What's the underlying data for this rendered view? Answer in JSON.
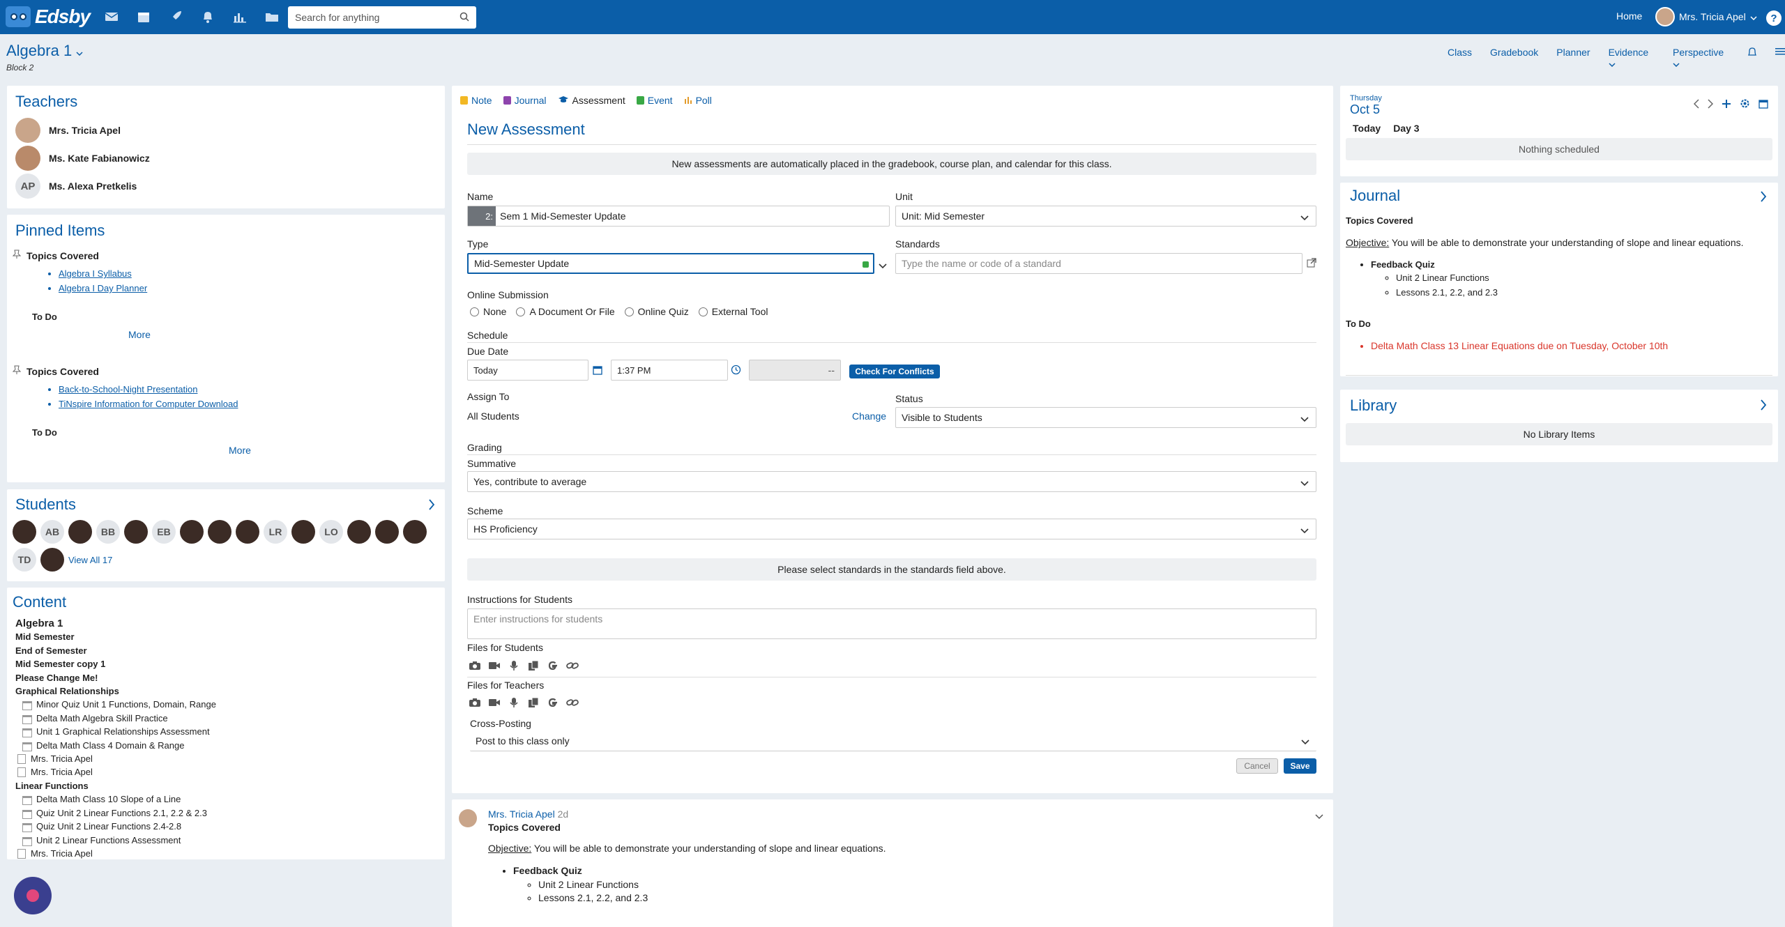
{
  "topbar": {
    "logo_text": "Edsby",
    "icons": [
      "mail-icon",
      "calendar-icon",
      "rocket-icon",
      "bell-icon",
      "chart-icon",
      "folder-icon"
    ],
    "search_placeholder": "Search for anything",
    "home_label": "Home",
    "user_name": "Mrs. Tricia Apel",
    "help_label": "?"
  },
  "class_header": {
    "title": "Algebra 1",
    "subtitle": "Block 2",
    "nav": [
      "Class",
      "Gradebook",
      "Planner",
      "Evidence",
      "Perspective"
    ]
  },
  "teachers": {
    "title": "Teachers",
    "items": [
      {
        "name": "Mrs. Tricia Apel",
        "initials": ""
      },
      {
        "name": "Ms. Kate Fabianowicz",
        "initials": ""
      },
      {
        "name": "Ms. Alexa Pretkelis",
        "initials": "AP"
      }
    ]
  },
  "pinned": {
    "title": "Pinned Items",
    "groups": [
      {
        "heading": "Topics Covered",
        "links": [
          "Algebra I Syllabus",
          "Algebra I Day Planner"
        ],
        "todo": "To Do",
        "more": "More"
      },
      {
        "heading": "Topics Covered",
        "links": [
          "Back-to-School-Night Presentation",
          "TiNspire Information for Computer Download"
        ],
        "todo": "To Do",
        "more": "More"
      }
    ]
  },
  "students": {
    "title": "Students",
    "row1": [
      "",
      "AB",
      "",
      "BB",
      "",
      "EB",
      "",
      "",
      "",
      "LR",
      "",
      "LO",
      "",
      "",
      ""
    ],
    "row2": [
      "TD",
      ""
    ],
    "view_all": "View All 17"
  },
  "content": {
    "title": "Content",
    "items": [
      {
        "text": "Algebra 1",
        "style": "b big"
      },
      {
        "text": "Mid Semester",
        "style": "b"
      },
      {
        "text": "End of Semester",
        "style": "b"
      },
      {
        "text": "Mid Semester copy 1",
        "style": "b"
      },
      {
        "text": "Please Change Me!",
        "style": "b"
      },
      {
        "text": "Graphical Relationships",
        "style": "b"
      },
      {
        "text": "Minor Quiz Unit 1 Functions, Domain, Range",
        "style": "ind"
      },
      {
        "text": "Delta Math Algebra Skill Practice",
        "style": "ind"
      },
      {
        "text": "Unit 1 Graphical Relationships Assessment",
        "style": "ind"
      },
      {
        "text": "Delta Math Class 4 Domain & Range",
        "style": "ind"
      },
      {
        "text": "Mrs. Tricia Apel",
        "style": "doc"
      },
      {
        "text": "Mrs. Tricia Apel",
        "style": "doc"
      },
      {
        "text": "Linear Functions",
        "style": "b"
      },
      {
        "text": "Delta Math Class 10 Slope of a Line",
        "style": "ind"
      },
      {
        "text": "Quiz Unit 2 Linear Functions 2.1, 2.2 & 2.3",
        "style": "ind"
      },
      {
        "text": "Quiz Unit 2 Linear Functions 2.4-2.8",
        "style": "ind"
      },
      {
        "text": "Unit 2 Linear Functions Assessment",
        "style": "ind"
      },
      {
        "text": "Mrs. Tricia Apel",
        "style": "doc"
      }
    ]
  },
  "composer": {
    "tabs": [
      {
        "label": "Note",
        "color": "#f2b824"
      },
      {
        "label": "Journal",
        "color": "#8e44ad"
      },
      {
        "label": "Assessment",
        "color": "#0b5ea8"
      },
      {
        "label": "Event",
        "color": "#39a845"
      },
      {
        "label": "Poll",
        "color": "#e39b2a"
      }
    ],
    "heading": "New Assessment",
    "banner": "New assessments are automatically placed in the gradebook, course plan, and calendar for this class.",
    "name_label": "Name",
    "name_prefix": "2:",
    "name_value": "Sem 1 Mid-Semester Update",
    "unit_label": "Unit",
    "unit_value": "Unit: Mid Semester",
    "type_label": "Type",
    "type_value": "Mid-Semester Update",
    "standards_label": "Standards",
    "standards_placeholder": "Type the name or code of a standard",
    "online_label": "Online Submission",
    "online_options": [
      "None",
      "A Document Or File",
      "Online Quiz",
      "External Tool"
    ],
    "schedule_label": "Schedule",
    "due_label": "Due Date",
    "due_date": "Today",
    "due_time": "1:37 PM",
    "due_extra": "--",
    "conflicts_btn": "Check For Conflicts",
    "assign_label": "Assign To",
    "assign_value": "All Students",
    "change_link": "Change",
    "status_label": "Status",
    "status_value": "Visible to Students",
    "grading_label": "Grading",
    "summative_label": "Summative",
    "summative_value": "Yes, contribute to average",
    "scheme_label": "Scheme",
    "scheme_value": "HS Proficiency",
    "standards_notice": "Please select standards in the standards field above.",
    "instructions_label": "Instructions for Students",
    "instructions_placeholder": "Enter instructions for students",
    "files_students_label": "Files for Students",
    "files_teachers_label": "Files for Teachers",
    "file_icons": [
      "camera-icon",
      "video-icon",
      "mic-icon",
      "copy-icon",
      "google-icon",
      "link-icon"
    ],
    "crosspost_label": "Cross-Posting",
    "crosspost_value": "Post to this class only",
    "cancel_btn": "Cancel",
    "save_btn": "Save"
  },
  "post": {
    "author": "Mrs. Tricia Apel",
    "age": "2d",
    "title": "Topics Covered",
    "objective_label": "Objective:",
    "objective_text": " You will be able to demonstrate your understanding of slope and linear equations.",
    "quiz": "Feedback Quiz",
    "subitems": [
      "Unit 2 Linear Functions",
      "Lessons 2.1, 2.2, and 2.3"
    ]
  },
  "calendar": {
    "weekday": "Thursday",
    "date": "Oct 5",
    "today_label": "Today",
    "day_label": "Day 3",
    "empty": "Nothing scheduled"
  },
  "journal": {
    "title": "Journal",
    "heading": "Topics Covered",
    "objective_label": "Objective:",
    "objective_text": " You will be able to demonstrate your understanding of slope and linear equations.",
    "quiz": "Feedback Quiz",
    "subitems": [
      "Unit 2 Linear Functions",
      "Lessons 2.1, 2.2, and 2.3"
    ],
    "todo_label": "To Do",
    "todo_item": "Delta Math Class 13 Linear Equations due on Tuesday, October 10th"
  },
  "library": {
    "title": "Library",
    "empty": "No Library Items"
  }
}
